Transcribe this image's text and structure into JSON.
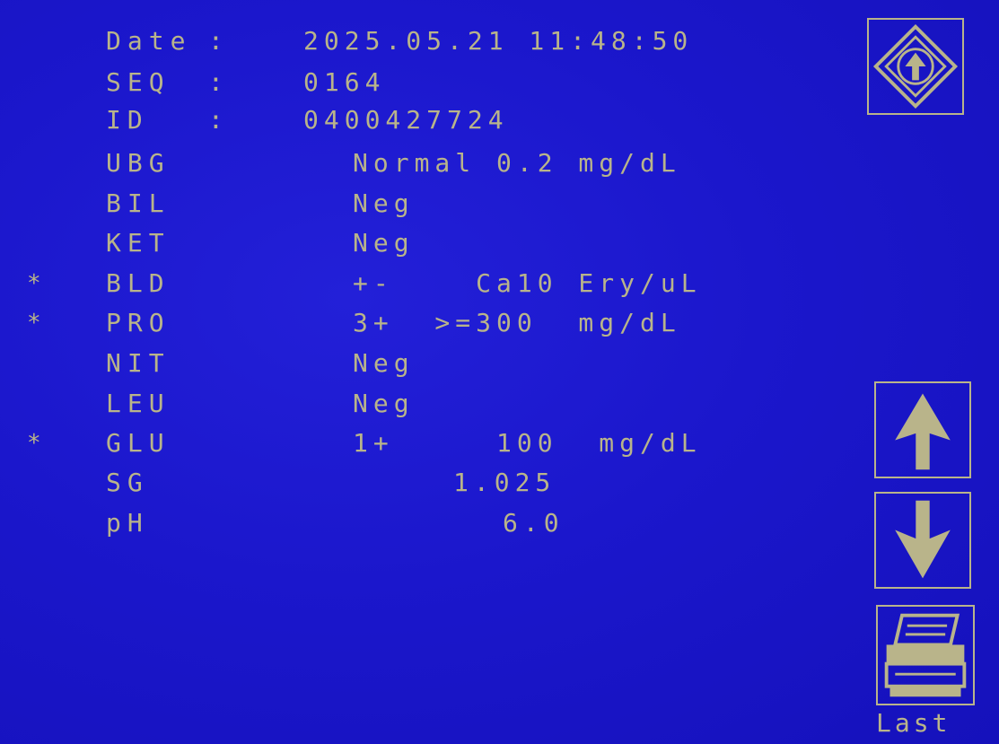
{
  "header": {
    "date_label": "Date",
    "seq_label": "SEQ",
    "id_label": "ID",
    "separator": ":",
    "date_value": "2025.05.21 11:48:50",
    "seq_value": "0164",
    "id_value": "0400427724"
  },
  "results": [
    {
      "flag": "",
      "name": "UBG",
      "result": "Normal 0.2 mg/dL"
    },
    {
      "flag": "",
      "name": "BIL",
      "result": "Neg"
    },
    {
      "flag": "",
      "name": "KET",
      "result": "Neg"
    },
    {
      "flag": "*",
      "name": "BLD",
      "result": "+-    Ca10 Ery/uL"
    },
    {
      "flag": "*",
      "name": "PRO",
      "result": "3+  >=300  mg/dL"
    },
    {
      "flag": "",
      "name": "NIT",
      "result": "Neg"
    },
    {
      "flag": "",
      "name": "LEU",
      "result": "Neg"
    },
    {
      "flag": "*",
      "name": "GLU",
      "result": "1+     100  mg/dL"
    },
    {
      "flag": "",
      "name": "SG",
      "result": "1.025"
    },
    {
      "flag": "",
      "name": "pH",
      "result": "6.0"
    }
  ],
  "buttons": {
    "top_icon": "up-arrow-diamond-icon",
    "up_icon": "up-arrow-icon",
    "down_icon": "down-arrow-icon",
    "print_icon": "printer-icon",
    "last_label": "Last"
  },
  "colors": {
    "background": "#1a16c8",
    "text": "#b9b48a"
  }
}
